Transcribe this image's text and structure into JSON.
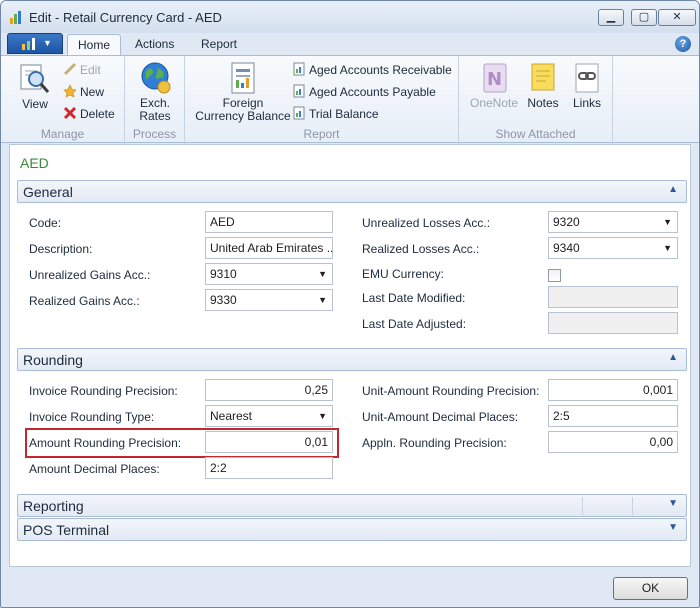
{
  "window": {
    "title": "Edit - Retail Currency Card - AED",
    "minimize": "▁",
    "restore": "▢",
    "close": "✕"
  },
  "menu": {
    "tabs": [
      "Home",
      "Actions",
      "Report"
    ],
    "help": "?"
  },
  "ribbon": {
    "manage": {
      "label": "Manage",
      "view": "View",
      "edit": "Edit",
      "new": "New",
      "delete": "Delete"
    },
    "process": {
      "label": "Process",
      "exch_rates_line1": "Exch.",
      "exch_rates_line2": "Rates"
    },
    "report": {
      "label": "Report",
      "foreign_line1": "Foreign",
      "foreign_line2": "Currency Balance",
      "items": [
        "Aged Accounts Receivable",
        "Aged Accounts Payable",
        "Trial Balance"
      ]
    },
    "show_attached": {
      "label": "Show Attached",
      "onenote": "OneNote",
      "notes": "Notes",
      "links": "Links"
    }
  },
  "card": {
    "title": "AED"
  },
  "general": {
    "title": "General",
    "code_label": "Code:",
    "code_value": "AED",
    "description_label": "Description:",
    "description_value": "United Arab Emirates ...",
    "unrealized_gains_label": "Unrealized Gains Acc.:",
    "unrealized_gains_value": "9310",
    "realized_gains_label": "Realized Gains Acc.:",
    "realized_gains_value": "9330",
    "unrealized_losses_label": "Unrealized Losses Acc.:",
    "unrealized_losses_value": "9320",
    "realized_losses_label": "Realized Losses Acc.:",
    "realized_losses_value": "9340",
    "emu_label": "EMU Currency:",
    "last_modified_label": "Last Date Modified:",
    "last_adjusted_label": "Last Date Adjusted:"
  },
  "rounding": {
    "title": "Rounding",
    "invoice_precision_label": "Invoice Rounding Precision:",
    "invoice_precision_value": "0,25",
    "invoice_type_label": "Invoice Rounding Type:",
    "invoice_type_value": "Nearest",
    "amount_precision_label": "Amount Rounding Precision:",
    "amount_precision_value": "0,01",
    "amount_decimals_label": "Amount Decimal Places:",
    "amount_decimals_value": "2:2",
    "unit_precision_label": "Unit-Amount Rounding Precision:",
    "unit_precision_value": "0,001",
    "unit_decimals_label": "Unit-Amount Decimal Places:",
    "unit_decimals_value": "2:5",
    "appln_precision_label": "Appln. Rounding Precision:",
    "appln_precision_value": "0,00"
  },
  "reporting": {
    "title": "Reporting"
  },
  "pos": {
    "title": "POS Terminal"
  },
  "footer": {
    "ok": "OK"
  },
  "colors": {
    "accent": "#2b5797",
    "card_title": "#3a8a3a",
    "highlight": "#c0282d"
  }
}
